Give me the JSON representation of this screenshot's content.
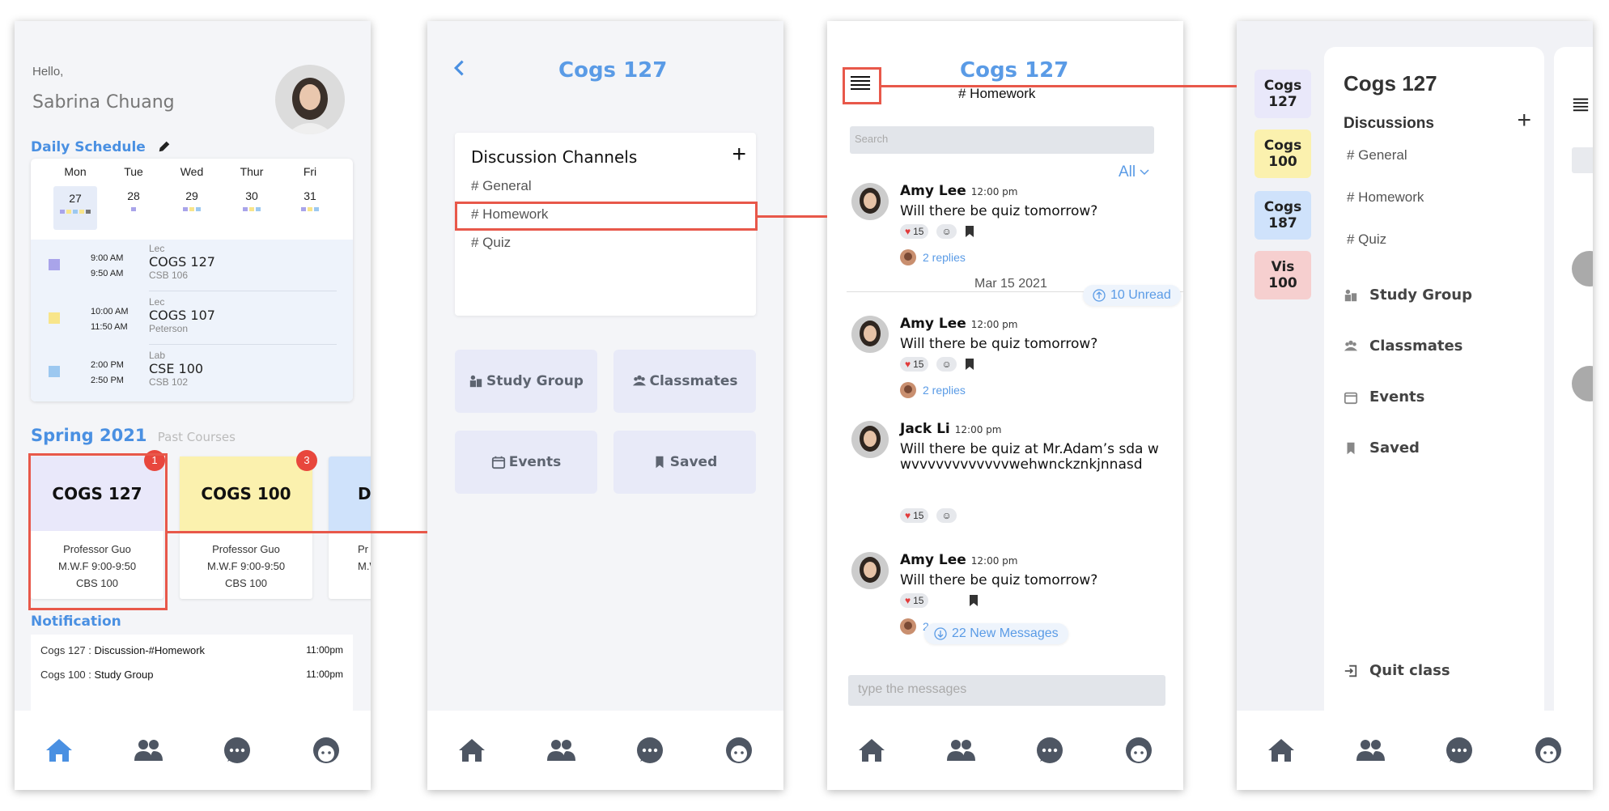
{
  "screen1": {
    "hello": "Hello,",
    "user_name": "Sabrina Chuang",
    "daily_schedule_label": "Daily Schedule",
    "days": [
      {
        "name": "Mon",
        "date": "27"
      },
      {
        "name": "Tue",
        "date": "28"
      },
      {
        "name": "Wed",
        "date": "29"
      },
      {
        "name": "Thur",
        "date": "30"
      },
      {
        "name": "Fri",
        "date": "31"
      }
    ],
    "classes": [
      {
        "start": "9:00 AM",
        "end": "9:50 AM",
        "type": "Lec",
        "course": "COGS 127",
        "room": "CSB 106",
        "color": "#a9a4ea"
      },
      {
        "start": "10:00 AM",
        "end": "11:50 AM",
        "type": "Lec",
        "course": "COGS 107",
        "room": "Peterson",
        "color": "#f8e58a"
      },
      {
        "start": "2:00 PM",
        "end": "2:50 PM",
        "type": "Lab",
        "course": "CSE 100",
        "room": "CSB 102",
        "color": "#9cc8f0"
      }
    ],
    "term_title": "Spring 2021",
    "past_courses_label": "Past Courses",
    "courses": [
      {
        "code": "COGS 127",
        "professor": "Professor Guo",
        "schedule": "M.W.F  9:00-9:50",
        "room": "CBS 100",
        "badge": "1",
        "color": "#e9e8fa"
      },
      {
        "code": "COGS 100",
        "professor": "Professor Guo",
        "schedule": "M.W.F  9:00-9:50",
        "room": "CBS 100",
        "badge": "3",
        "color": "#fbf1ae"
      },
      {
        "code": "D",
        "professor": "Pr",
        "schedule": "M.W",
        "room": "",
        "color": "#cfe2fb"
      }
    ],
    "notification_label": "Notification",
    "notifications": [
      {
        "course": "Cogs 127 :",
        "text": "Discussion-#Homework",
        "time": "11:00pm"
      },
      {
        "course": "Cogs 100 :",
        "text": "Study Group",
        "time": "11:00pm"
      }
    ]
  },
  "screen2": {
    "title": "Cogs 127",
    "channels_title": "Discussion Channels",
    "plus": "+",
    "channels": [
      "# General",
      "# Homework",
      "# Quiz"
    ],
    "tiles": [
      "Study Group",
      "Classmates",
      "Events",
      "Saved"
    ]
  },
  "screen3": {
    "title": "Cogs 127",
    "subtitle": "# Homework",
    "search_placeholder": "Search",
    "filter": "All",
    "date_divider": "Mar 15 2021",
    "unread": "10 Unread",
    "new_messages": "22 New Messages",
    "compose_placeholder": "type the messages",
    "messages": [
      {
        "author": "Amy Lee",
        "time": "12:00 pm",
        "text": "Will there be quiz tomorrow?",
        "likes": "15",
        "replies": "2 replies"
      },
      {
        "author": "Amy Lee",
        "time": "12:00 pm",
        "text": "Will there be quiz tomorrow?",
        "likes": "15",
        "replies": "2 replies"
      },
      {
        "author": "Jack Li",
        "time": "12:00 pm",
        "text": "Will there be quiz at Mr.Adam’s  sda wwvvvvvvvvvvvvwehwnckznkjnnasd",
        "likes": "15"
      },
      {
        "author": "Amy Lee",
        "time": "12:00 pm",
        "text": "Will there be quiz tomorrow?",
        "likes": "15",
        "replies": "2"
      }
    ]
  },
  "screen4": {
    "rail": [
      {
        "l1": "Cogs",
        "l2": "127",
        "color": "#e9e8fa"
      },
      {
        "l1": "Cogs",
        "l2": "100",
        "color": "#fbf1ae"
      },
      {
        "l1": "Cogs",
        "l2": "187",
        "color": "#cfe2fb"
      },
      {
        "l1": "Vis",
        "l2": "100",
        "color": "#f6cfcf"
      }
    ],
    "title": "Cogs 127",
    "discussions_label": "Discussions",
    "plus": "+",
    "channels": [
      "# General",
      "# Homework",
      "# Quiz"
    ],
    "items": [
      "Study Group",
      "Classmates",
      "Events",
      "Saved"
    ],
    "quit": "Quit class"
  },
  "colors": {
    "accent": "#4a90e2",
    "annotation": "#e8584a",
    "nav_active": "#4a90e2",
    "nav_inactive": "#4e5663"
  }
}
